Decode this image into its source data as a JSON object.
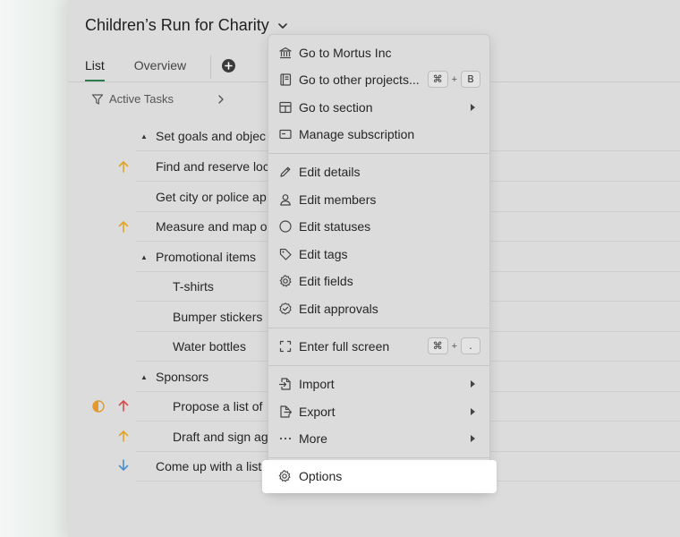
{
  "project": {
    "title": "Children’s Run for Charity"
  },
  "tabs": [
    {
      "label": "List"
    },
    {
      "label": "Overview"
    }
  ],
  "filter": {
    "label": "Active Tasks"
  },
  "tasks": [
    {
      "label": "Set goals and objec",
      "caret": "▲",
      "priority": ""
    },
    {
      "label": "Find and reserve loc",
      "caret": "",
      "priority": "high"
    },
    {
      "label": "Get city or police ap",
      "caret": "",
      "priority": ""
    },
    {
      "label": "Measure and map o",
      "caret": "",
      "priority": "high"
    },
    {
      "label": "Promotional items",
      "caret": "▲",
      "priority": ""
    },
    {
      "label": "T-shirts",
      "caret": "",
      "priority": ""
    },
    {
      "label": "Bumper stickers",
      "caret": "",
      "priority": ""
    },
    {
      "label": "Water bottles",
      "caret": "",
      "priority": ""
    },
    {
      "label": "Sponsors",
      "caret": "▲",
      "priority": ""
    },
    {
      "label": "Propose a list of",
      "caret": "",
      "priority": "urgent",
      "status": "in-progress"
    },
    {
      "label": "Draft and sign ag",
      "caret": "",
      "priority": "high"
    },
    {
      "label": "Come up with a list",
      "caret": "",
      "priority": "low"
    }
  ],
  "menu": {
    "items": [
      {
        "label": "Go to Mortus Inc",
        "icon": "bank-icon"
      },
      {
        "label": "Go to other projects...",
        "icon": "notebook-icon",
        "shortcut": [
          "⌘",
          "+",
          "B"
        ]
      },
      {
        "label": "Go to section",
        "icon": "layout-icon"
      },
      {
        "label": "Manage subscription",
        "icon": "card-icon"
      },
      {
        "label": "Edit details",
        "icon": "pencil-icon"
      },
      {
        "label": "Edit members",
        "icon": "person-icon"
      },
      {
        "label": "Edit statuses",
        "icon": "circle-icon"
      },
      {
        "label": "Edit tags",
        "icon": "tag-icon"
      },
      {
        "label": "Edit fields",
        "icon": "gear-icon"
      },
      {
        "label": "Edit approvals",
        "icon": "check-circle-icon"
      },
      {
        "label": "Enter full screen",
        "icon": "fullscreen-icon",
        "shortcut": [
          "⌘",
          "+",
          "."
        ]
      },
      {
        "label": "Import",
        "icon": "import-icon"
      },
      {
        "label": "Export",
        "icon": "export-icon"
      },
      {
        "label": "More",
        "icon": "more-icon"
      },
      {
        "label": "Options",
        "icon": "gear-icon"
      }
    ]
  },
  "colors": {
    "accent": "#2f7a4b",
    "priority_high": "#e0a526",
    "priority_urgent": "#d94b4b",
    "priority_low": "#4a8fd0",
    "status_in_progress": "#e39a2c"
  }
}
